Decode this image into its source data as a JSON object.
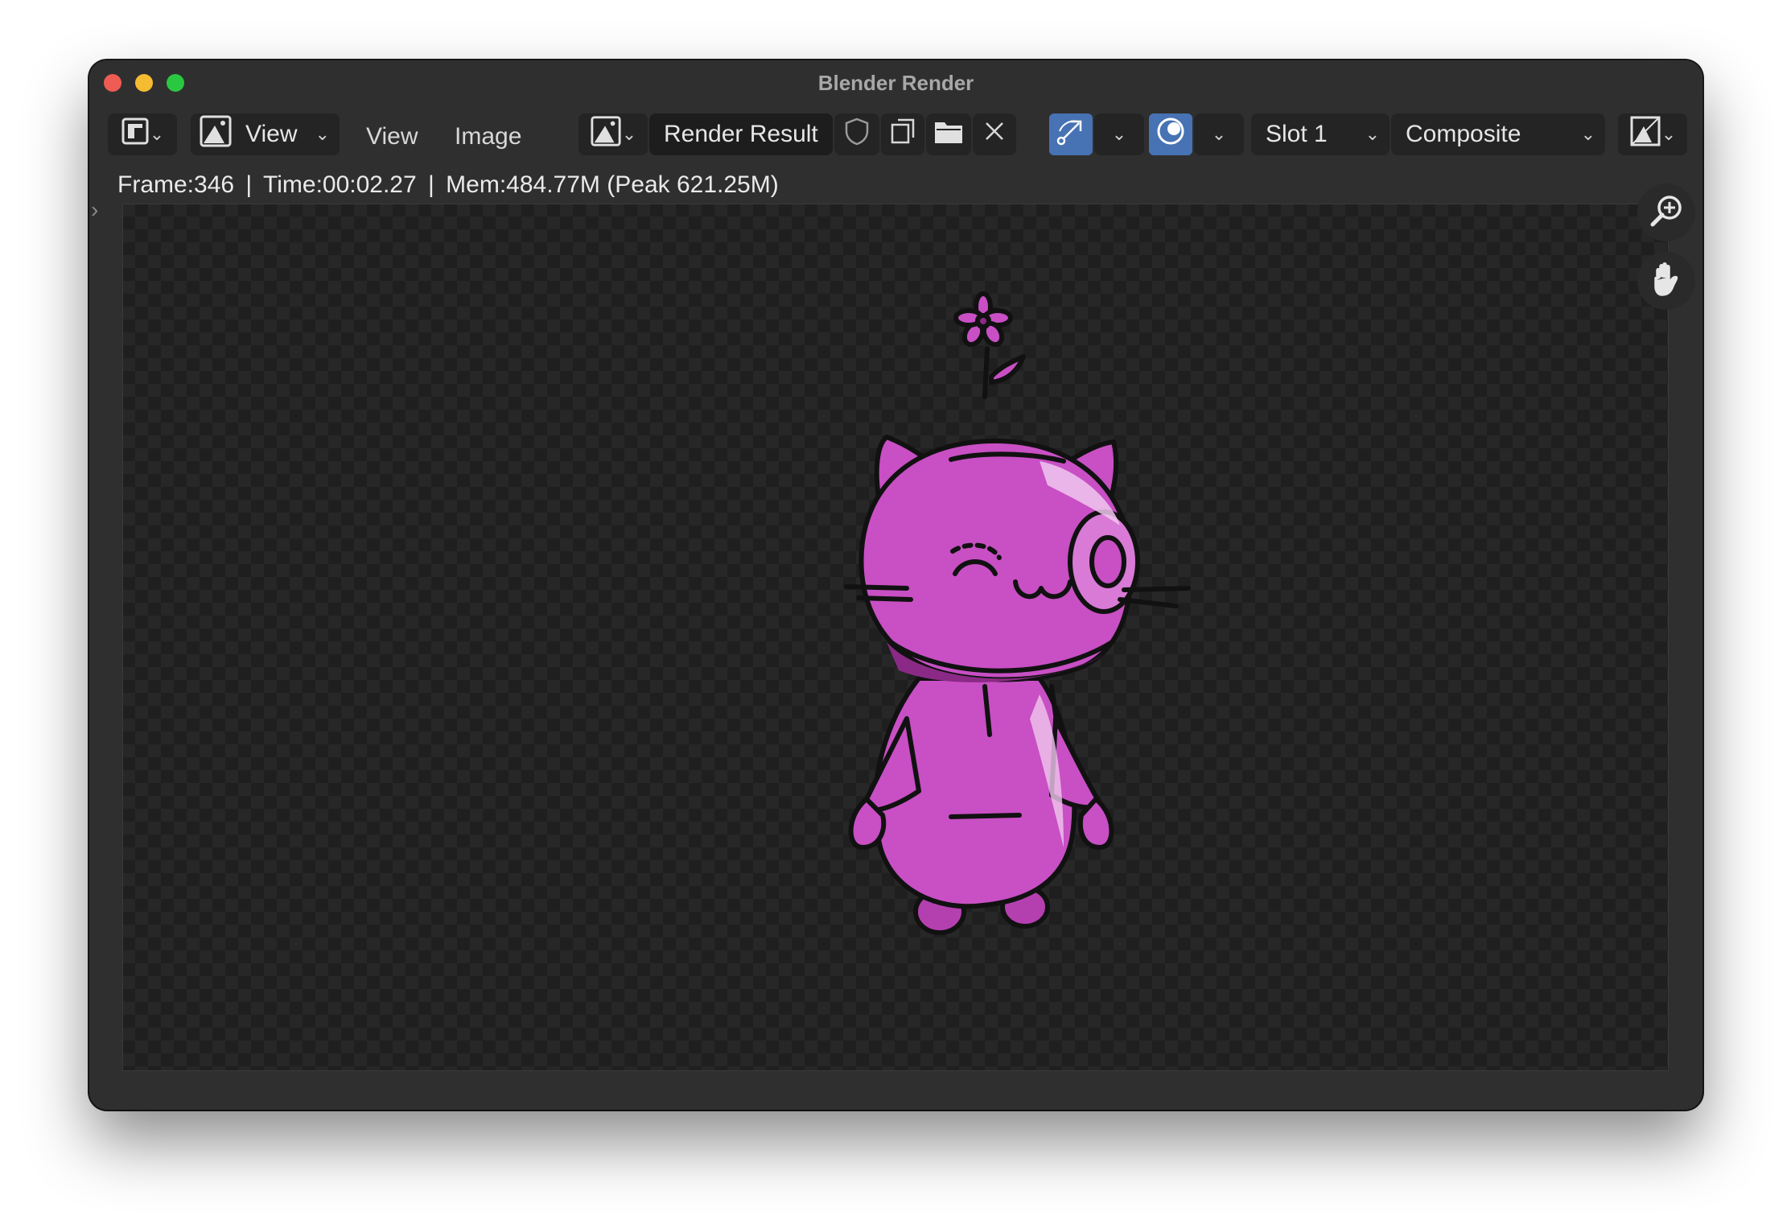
{
  "window": {
    "title": "Blender Render"
  },
  "header": {
    "view_dropdown_label": "View",
    "menus": [
      "View",
      "Image"
    ],
    "image_name": "Render Result",
    "slot": "Slot 1",
    "layer": "Composite"
  },
  "status": {
    "frame": "Frame:346",
    "time": "Time:00:02.27",
    "mem": "Mem:484.77M (Peak 621.25M)"
  },
  "icons": {
    "editor_type": "image-editor-icon",
    "mode": "image-icon",
    "browse": "image-browse-icon",
    "fake_user": "shield-icon",
    "new": "duplicate-icon",
    "open": "folder-icon",
    "unlink": "close-icon",
    "gizmo": "gizmo-icon",
    "overlay": "overlay-icon",
    "display": "display-channels-icon",
    "zoom": "zoom-icon",
    "pan": "hand-icon"
  },
  "colors": {
    "accent": "#4772b3",
    "character": "#c84fc4",
    "background": "#2f2f2f"
  }
}
